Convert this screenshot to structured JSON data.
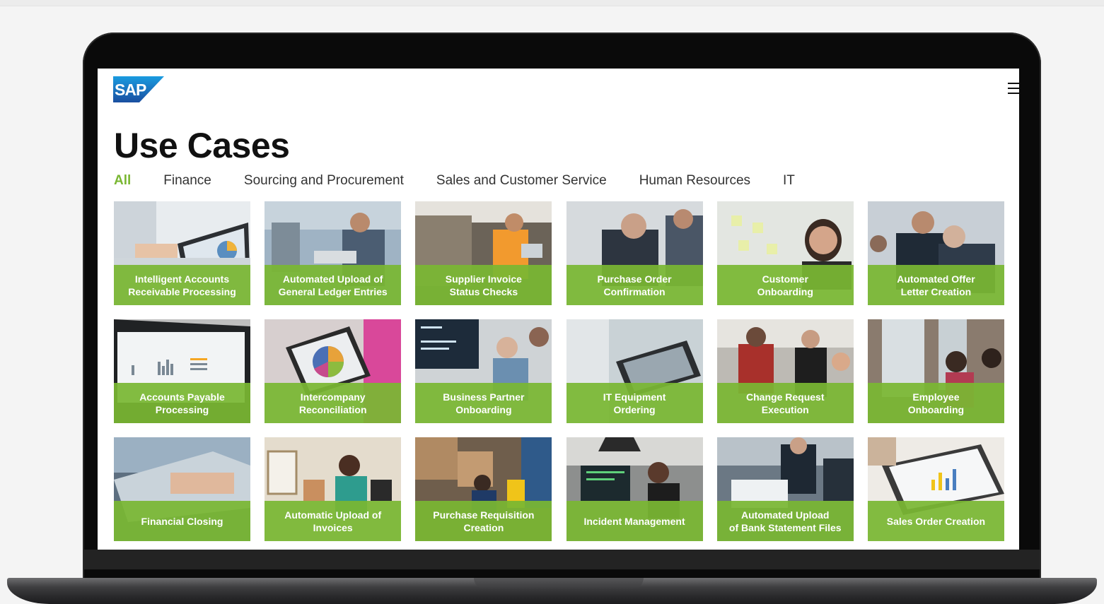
{
  "brand": {
    "logo_text": "SAP",
    "accent_color": "#7ab733",
    "logo_color": "#1e5aa8"
  },
  "header": {
    "menu_icon": "hamburger-menu-icon"
  },
  "page": {
    "title": "Use Cases"
  },
  "tabs": [
    {
      "label": "All",
      "active": true
    },
    {
      "label": "Finance"
    },
    {
      "label": "Sourcing and Procurement"
    },
    {
      "label": "Sales and Customer Service"
    },
    {
      "label": "Human Resources"
    },
    {
      "label": "IT"
    }
  ],
  "cards": [
    {
      "label": "Intelligent Accounts\nReceivable Processing"
    },
    {
      "label": "Automated Upload of\nGeneral Ledger Entries"
    },
    {
      "label": "Supplier Invoice\nStatus Checks"
    },
    {
      "label": "Purchase Order\nConfirmation"
    },
    {
      "label": "Customer\nOnboarding"
    },
    {
      "label": "Automated Offer\nLetter Creation"
    },
    {
      "label": "Accounts Payable\nProcessing"
    },
    {
      "label": "Intercompany\nReconciliation"
    },
    {
      "label": "Business Partner\nOnboarding"
    },
    {
      "label": "IT Equipment\nOrdering"
    },
    {
      "label": "Change Request\nExecution"
    },
    {
      "label": "Employee\nOnboarding"
    },
    {
      "label": "Financial Closing"
    },
    {
      "label": "Automatic Upload of\nInvoices"
    },
    {
      "label": "Purchase Requisition\nCreation"
    },
    {
      "label": "Incident Management"
    },
    {
      "label": "Automated Upload\nof Bank Statement Files"
    },
    {
      "label": "Sales Order Creation"
    }
  ]
}
